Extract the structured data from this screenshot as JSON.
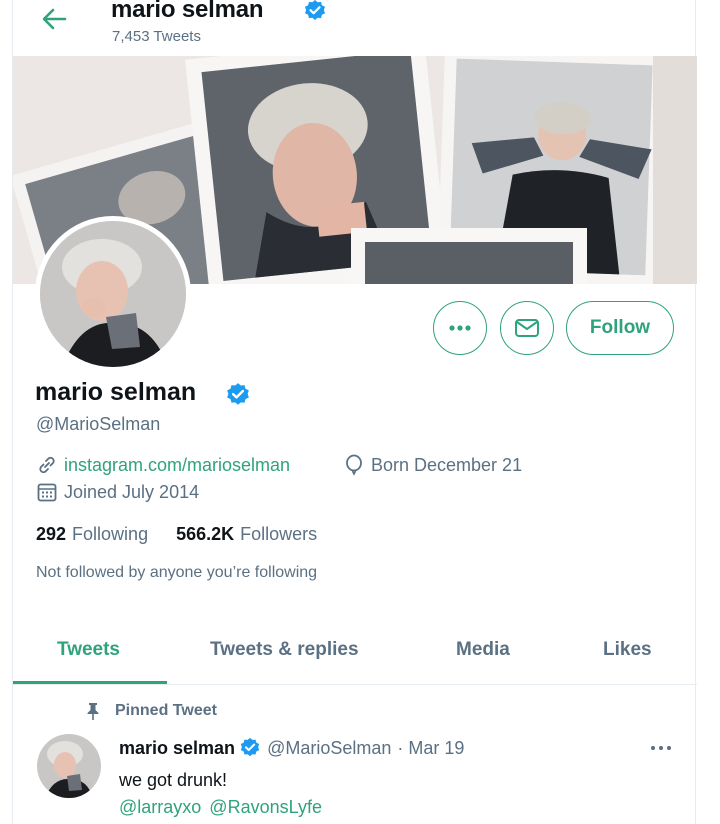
{
  "header": {
    "name": "mario selman",
    "tweet_count": "7,453 Tweets"
  },
  "profile": {
    "name": "mario selman",
    "handle": "@MarioSelman",
    "website": "instagram.com/marioselman",
    "birthday": "Born December 21",
    "joined": "Joined July 2014",
    "following_count": "292",
    "following_label": "Following",
    "followers_count": "566.2K",
    "followers_label": "Followers",
    "not_followed": "Not followed by anyone you’re following"
  },
  "actions": {
    "follow_label": "Follow"
  },
  "tabs": [
    {
      "label": "Tweets",
      "active": true
    },
    {
      "label": "Tweets & replies",
      "active": false
    },
    {
      "label": "Media",
      "active": false
    },
    {
      "label": "Likes",
      "active": false
    }
  ],
  "tweet": {
    "pinned_label": "Pinned Tweet",
    "author_name": "mario selman",
    "author_handle": "@MarioSelman",
    "date": "· Mar 19",
    "text": "we got drunk!",
    "mentions": [
      "@larrayxo",
      "@RavonsLyfe"
    ]
  },
  "colors": {
    "accent": "#2fa37a",
    "verified": "#1d9bf0",
    "muted": "#5b7083"
  },
  "icons": {
    "back": "arrow-left-icon",
    "verified": "verified-badge-icon",
    "more": "more-horizontal-icon",
    "message": "envelope-icon",
    "link": "link-icon",
    "birthday": "balloon-icon",
    "calendar": "calendar-icon",
    "pin": "pin-icon"
  }
}
